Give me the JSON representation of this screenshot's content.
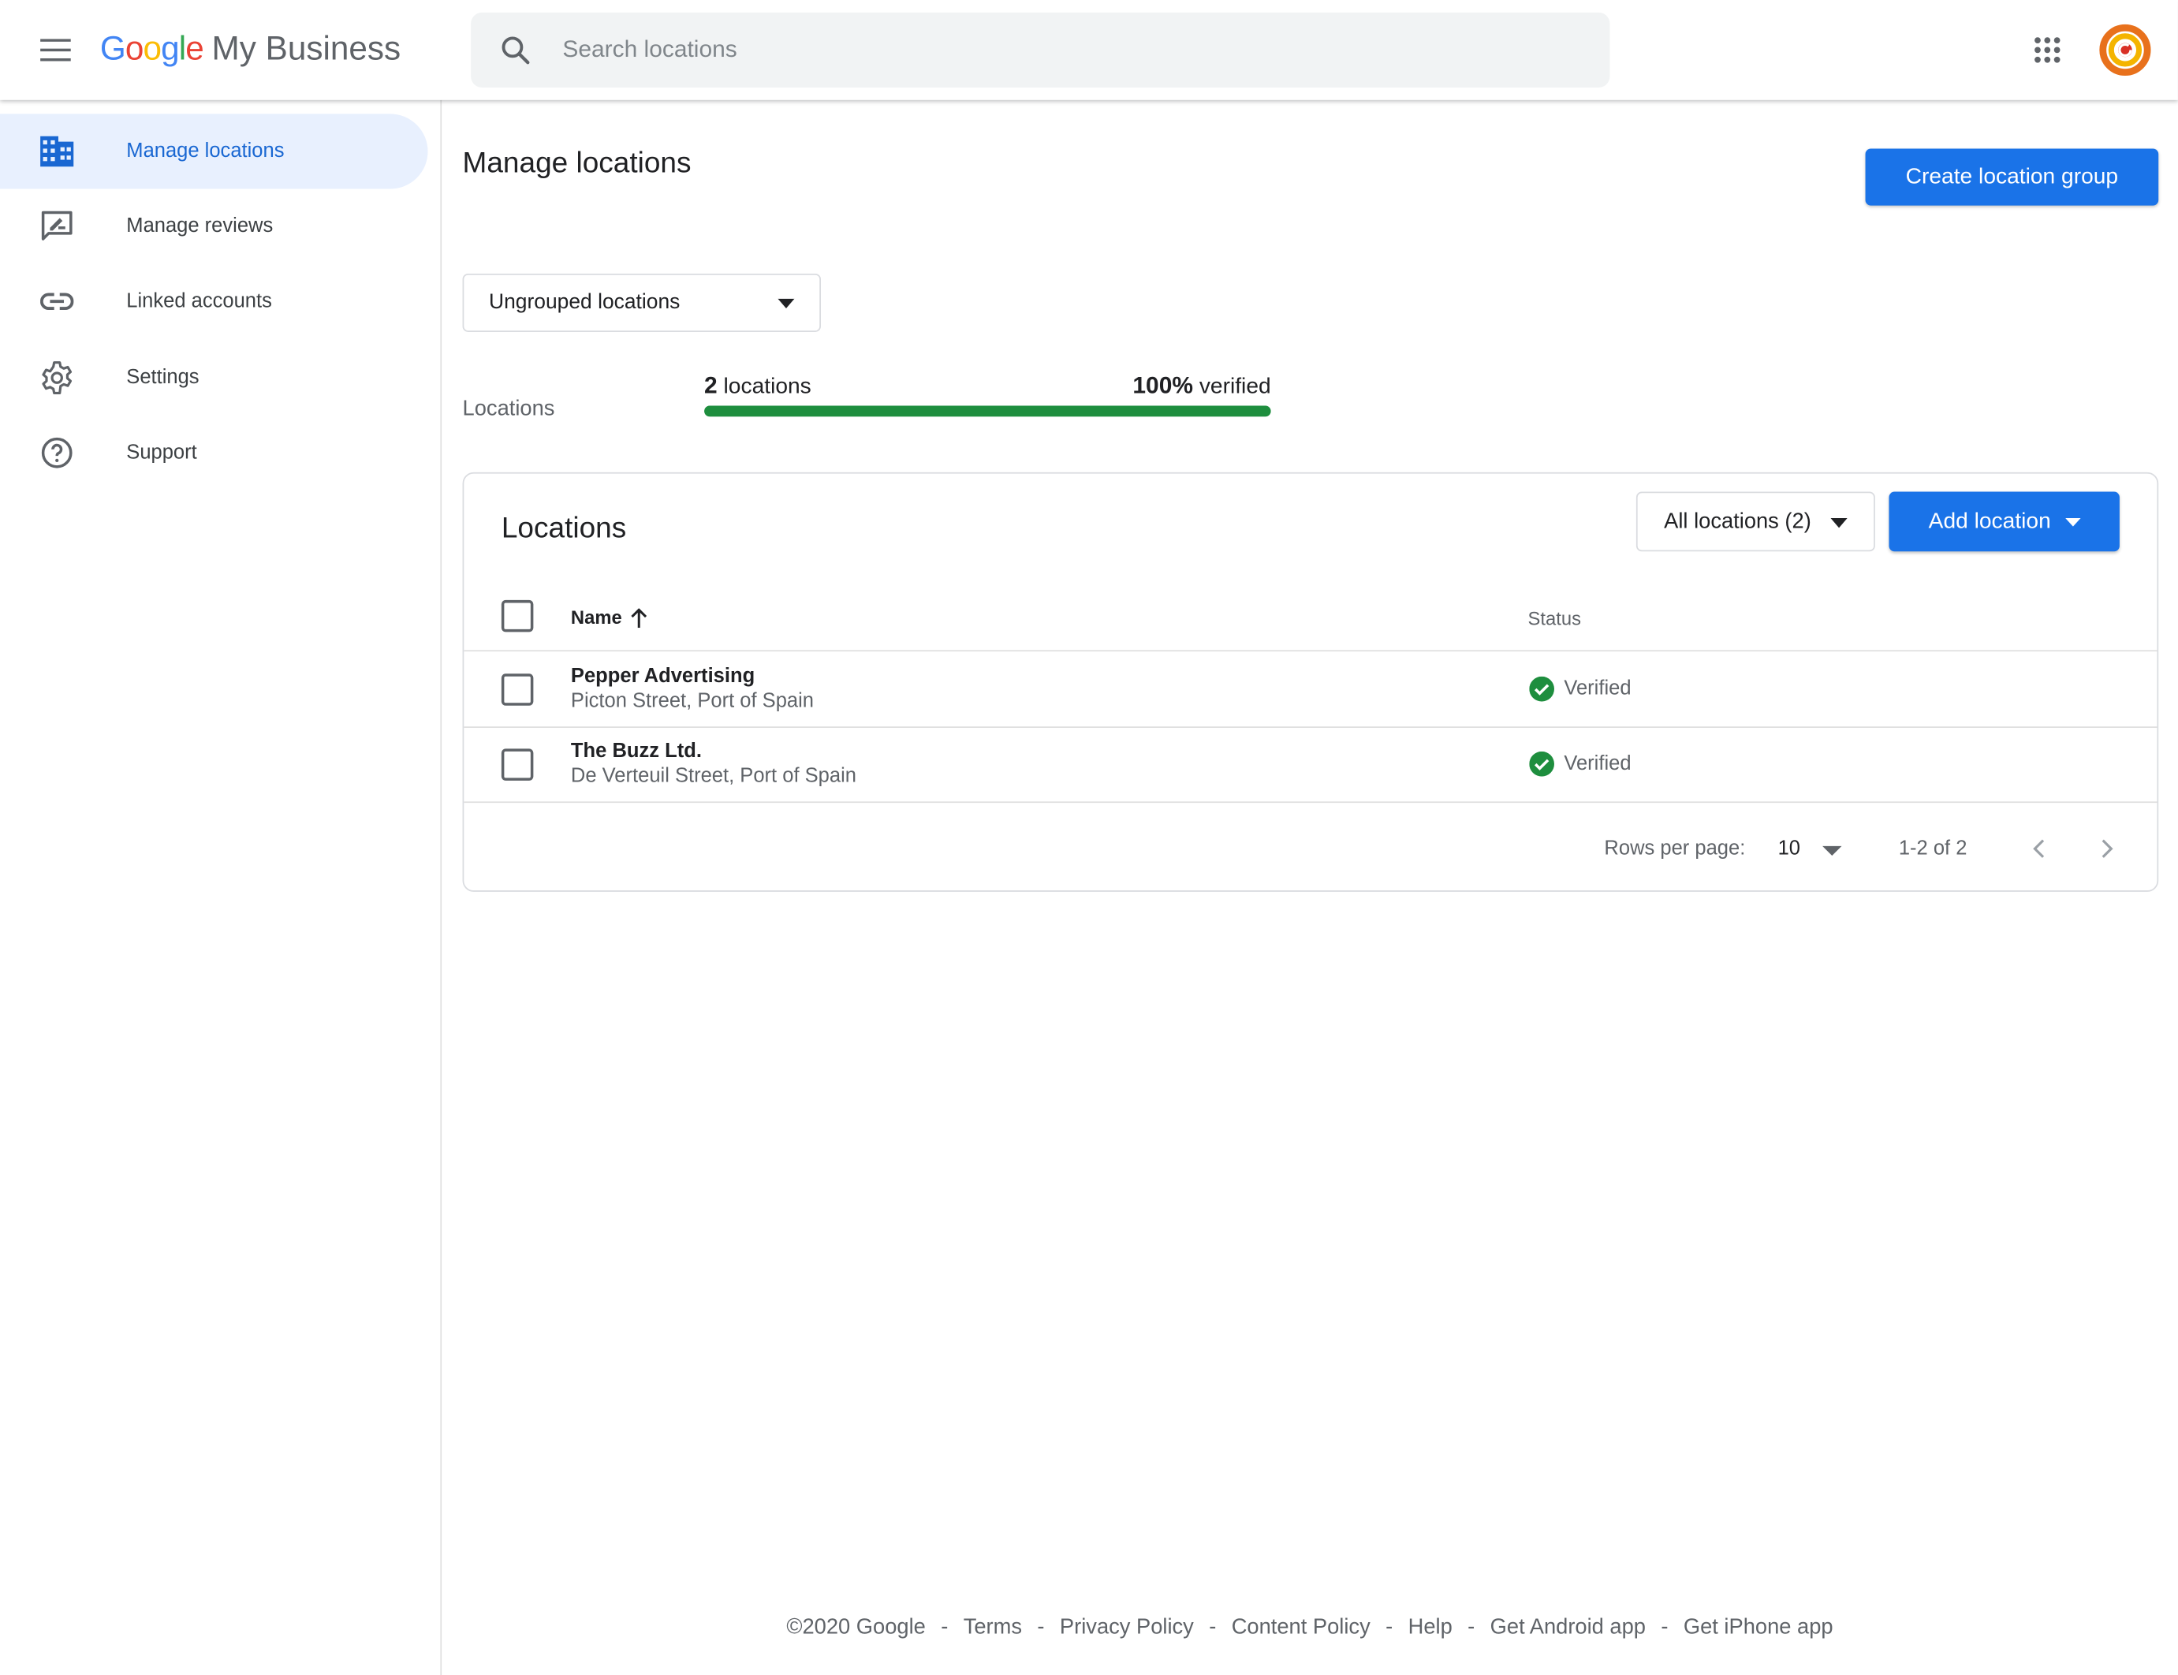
{
  "header": {
    "logo_google": "Google",
    "logo_product": "My Business",
    "search_placeholder": "Search locations",
    "icons": [
      "menu-icon",
      "search-icon",
      "apps-grid-icon",
      "avatar"
    ]
  },
  "sidebar": {
    "items": [
      {
        "label": "Manage locations",
        "icon": "building-icon",
        "active": true
      },
      {
        "label": "Manage reviews",
        "icon": "review-icon",
        "active": false
      },
      {
        "label": "Linked accounts",
        "icon": "link-icon",
        "active": false
      },
      {
        "label": "Settings",
        "icon": "gear-icon",
        "active": false
      },
      {
        "label": "Support",
        "icon": "help-icon",
        "active": false
      }
    ]
  },
  "main": {
    "title": "Manage locations",
    "create_group_label": "Create location group",
    "group_select_value": "Ungrouped locations",
    "stats": {
      "label": "Locations",
      "count_number": "2",
      "count_suffix": " locations",
      "verified_percent": "100%",
      "verified_suffix": " verified",
      "verified_fraction": 1.0
    }
  },
  "card": {
    "title": "Locations",
    "filter_value": "All locations (2)",
    "add_location_label": "Add location",
    "columns": {
      "name": "Name",
      "status": "Status"
    },
    "rows": [
      {
        "name": "Pepper Advertising",
        "address": "Picton Street, Port of Spain",
        "status": "Verified"
      },
      {
        "name": "The Buzz Ltd.",
        "address": "De Verteuil Street, Port of Spain",
        "status": "Verified"
      }
    ],
    "pagination": {
      "rows_per_page_label": "Rows per page:",
      "rows_per_page_value": "10",
      "range": "1-2 of 2"
    }
  },
  "footer": {
    "copyright": "©2020 Google",
    "links": [
      "Terms",
      "Privacy Policy",
      "Content Policy",
      "Help",
      "Get Android app",
      "Get iPhone app"
    ],
    "separator": "-"
  },
  "colors": {
    "primary": "#1a73e8",
    "active_nav_bg": "#e8f0fe",
    "active_nav_text": "#1967d2",
    "verified_green": "#1e8e3e"
  }
}
